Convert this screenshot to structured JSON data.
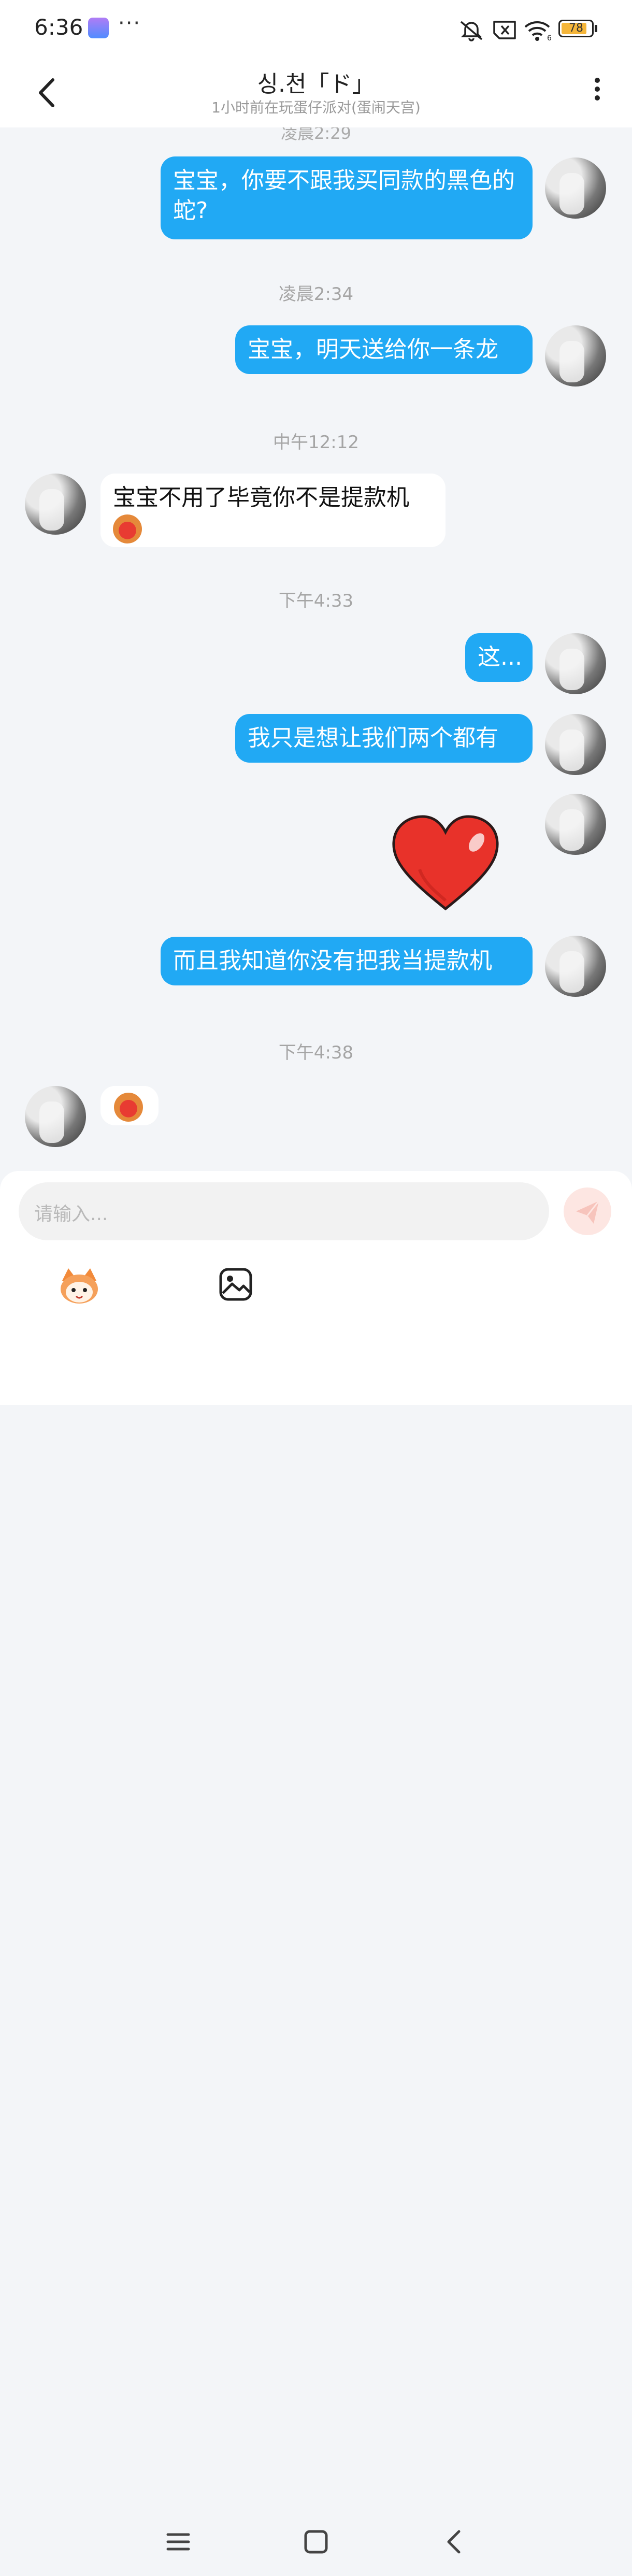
{
  "status_bar": {
    "time": "6:36",
    "more": "···",
    "battery": "78",
    "wifi_badge": "6"
  },
  "header": {
    "title": "싱.천「ド」",
    "subtitle": "1小时前在玩蛋仔派对(蛋闹天宫)"
  },
  "chat": {
    "cut_timestamp": "凌晨2:29",
    "timestamps": {
      "t1": "凌晨2:34",
      "t2": "中午12:12",
      "t3": "下午4:33",
      "t4": "下午4:38"
    },
    "messages": {
      "m1": "宝宝，你要不跟我买同款的黑色的蛇?",
      "m2": "宝宝，明天送给你一条龙",
      "m3": "宝宝不用了毕竟你不是提款机",
      "m4": "这...",
      "m5": "我只是想让我们两个都有",
      "m6": "而且我知道你没有把我当提款机"
    }
  },
  "input": {
    "placeholder": "请输入..."
  },
  "colors": {
    "self_bubble": "#21a9f4",
    "other_bubble": "#ffffff",
    "background": "#f3f5f8",
    "timestamp": "#a5a5a5"
  },
  "icons": [
    "back-icon",
    "more-icon",
    "send-icon",
    "emoji-mascot-icon",
    "image-icon",
    "menu-icon",
    "home-icon",
    "nav-back-icon"
  ]
}
